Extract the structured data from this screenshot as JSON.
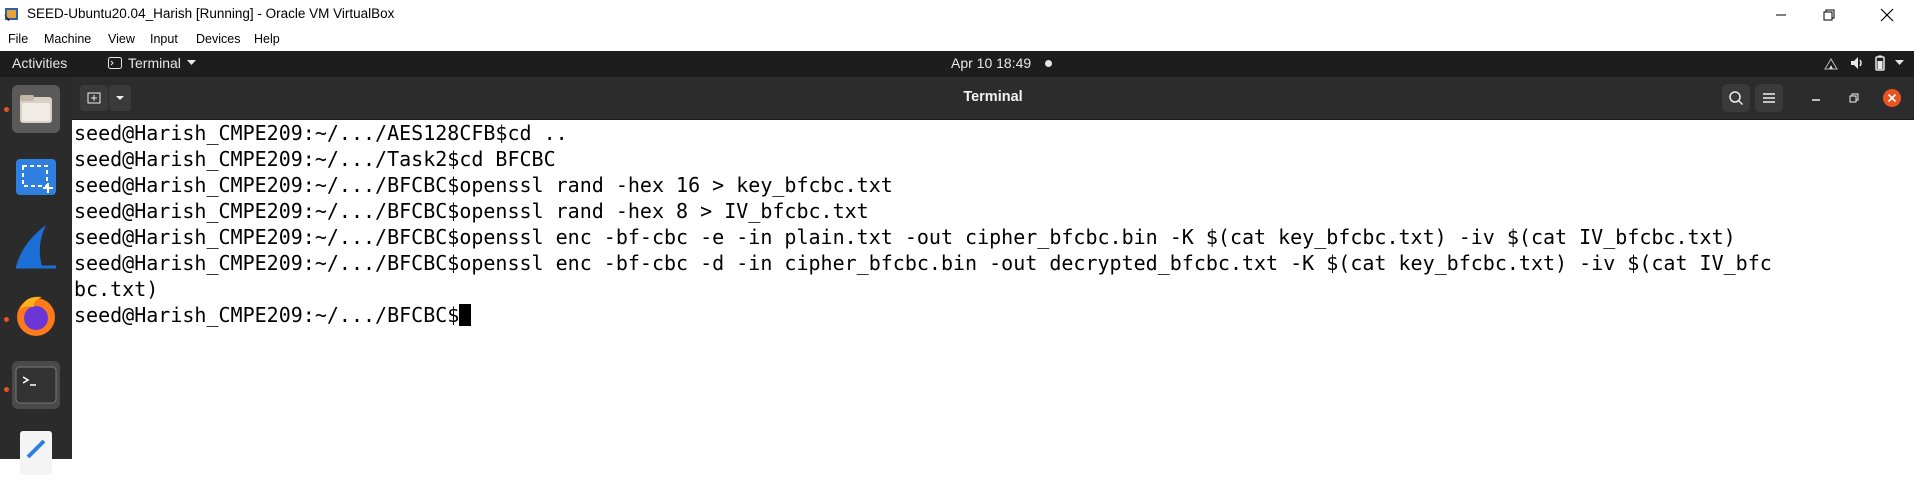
{
  "window": {
    "title": "SEED-Ubuntu20.04_Harish [Running] - Oracle VM VirtualBox"
  },
  "host_menu": [
    "File",
    "Machine",
    "View",
    "Input",
    "Devices",
    "Help"
  ],
  "gnome": {
    "activities": "Activities",
    "app_name": "Terminal",
    "clock": "Apr 10  18:49"
  },
  "terminal": {
    "title": "Terminal",
    "lines": [
      "seed@Harish_CMPE209:~/.../AES128CFB$cd ..",
      "seed@Harish_CMPE209:~/.../Task2$cd BFCBC",
      "seed@Harish_CMPE209:~/.../BFCBC$openssl rand -hex 16 > key_bfcbc.txt",
      "seed@Harish_CMPE209:~/.../BFCBC$openssl rand -hex 8 > IV_bfcbc.txt",
      "seed@Harish_CMPE209:~/.../BFCBC$openssl enc -bf-cbc -e -in plain.txt -out cipher_bfcbc.bin -K $(cat key_bfcbc.txt) -iv $(cat IV_bfcbc.txt)",
      "seed@Harish_CMPE209:~/.../BFCBC$openssl enc -bf-cbc -d -in cipher_bfcbc.bin -out decrypted_bfcbc.txt -K $(cat key_bfcbc.txt) -iv $(cat IV_bfc",
      "bc.txt)",
      "seed@Harish_CMPE209:~/.../BFCBC$"
    ]
  },
  "dock_icons": [
    "files-icon",
    "screenshot-icon",
    "wireshark-icon",
    "firefox-icon",
    "terminal-icon",
    "text-editor-icon"
  ],
  "colors": {
    "ubuntu_orange": "#e95420",
    "close_red": "#e95420",
    "dock_bg": "#2b2b2b",
    "topbar_bg": "#1d1d1d"
  }
}
